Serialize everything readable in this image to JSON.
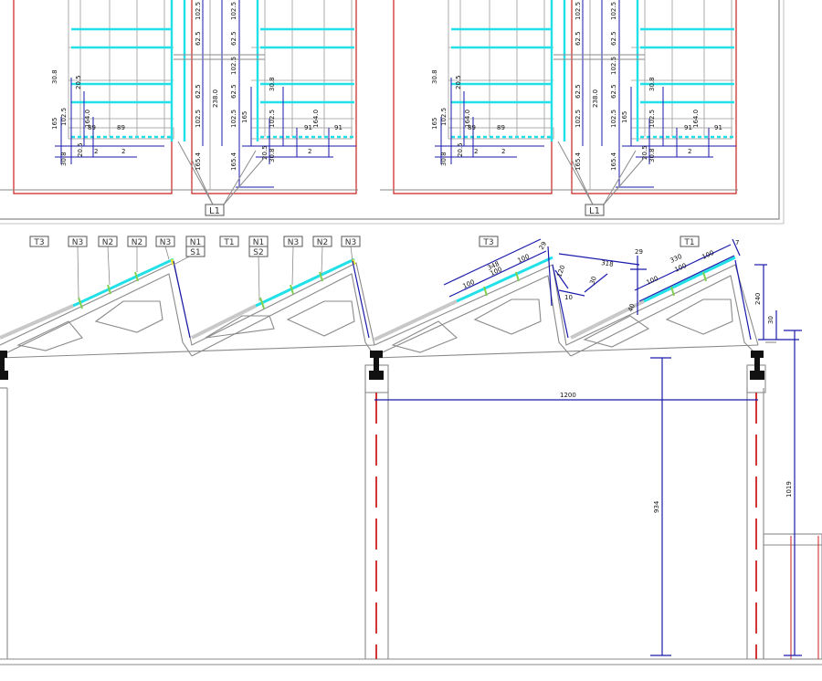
{
  "labels": {
    "leader_l1": "L1",
    "t3": "T3",
    "n3": "N3",
    "n2": "N2",
    "n1": "N1",
    "s1": "S1",
    "t1": "T1",
    "s2": "S2"
  },
  "plan_dims": {
    "v102_5": "102.5",
    "v62_5": "62.5",
    "v238_0": "238.0",
    "v165_4": "165.4",
    "v165": "165",
    "v30_8": "30.8",
    "v20_5": "20.5",
    "v164_0": "164.0",
    "v89": "89",
    "v91": "91",
    "v2": "2"
  },
  "section_dims": {
    "d348": "348",
    "d100": "100",
    "d29": "29",
    "d318": "318",
    "d30": "30",
    "d10": "10",
    "d330": "330",
    "d7": "7",
    "d240": "240",
    "d1200": "1200",
    "d934": "934",
    "d1019": "1019",
    "d120": "120",
    "d40": "40"
  },
  "colors": {
    "linework": "#8a8a8a",
    "dimension": "#1a1aaa",
    "panel_cyan": "#22e0e8",
    "axis_red": "#cc1f1f",
    "panel_green": "#7fd14f",
    "panel_yellow": "#e6e62a"
  }
}
